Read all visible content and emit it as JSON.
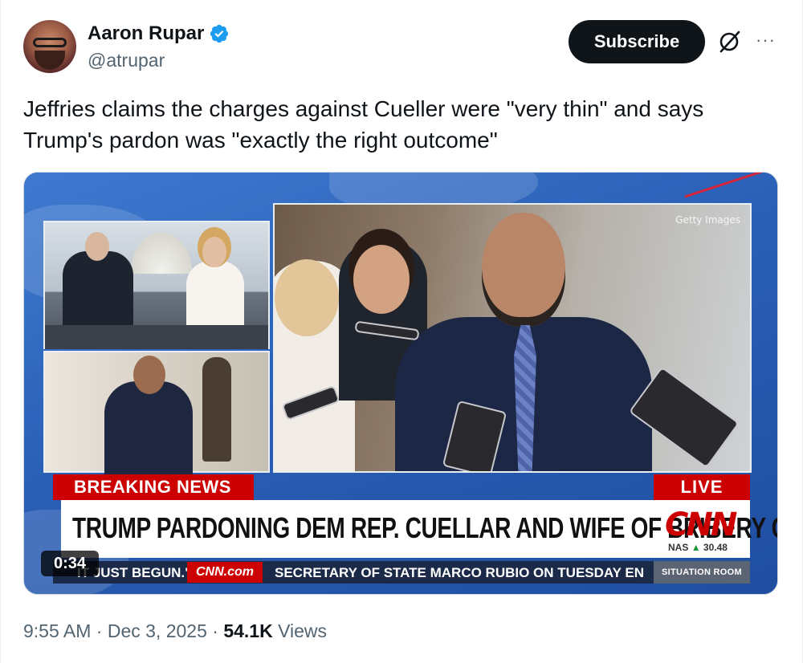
{
  "author": {
    "name": "Aaron Rupar",
    "handle": "@atrupar",
    "verified": true,
    "avatar_icon": "avatar-photo"
  },
  "actions": {
    "subscribe_label": "Subscribe",
    "grok_icon": "grok-slash-icon",
    "more_icon": "more-options-icon",
    "more_glyph": "···"
  },
  "tweet": {
    "text": "Jeffries claims the charges against Cueller were \"very thin\" and says Trump's pardon was \"exactly the right outcome\""
  },
  "video": {
    "duration": "0:34",
    "watermark": "Getty Images",
    "breaking_label": "BREAKING NEWS",
    "live_label": "LIVE",
    "headline": "TRUMP PARDONING DEM REP. CUELLAR AND WIFE OF BRIBERY CHARGES",
    "network_logo": "CNN",
    "market": {
      "index": "NAS",
      "arrow": "▲",
      "value": "30.48"
    },
    "ticker": {
      "left_text": "IT JUST BEGUN.\"",
      "site": "CNN.com",
      "main_text": "SECRETARY OF STATE MARCO RUBIO ON TUESDAY EN",
      "show": "SITUATION ROOM"
    }
  },
  "meta": {
    "time": "9:55 AM",
    "sep1": " · ",
    "date": "Dec 3, 2025",
    "sep2": " · ",
    "views_count": "54.1K",
    "views_label": " Views"
  },
  "colors": {
    "brand_red": "#cc0000",
    "verified_blue": "#1d9bf0",
    "text_secondary": "#536471"
  }
}
